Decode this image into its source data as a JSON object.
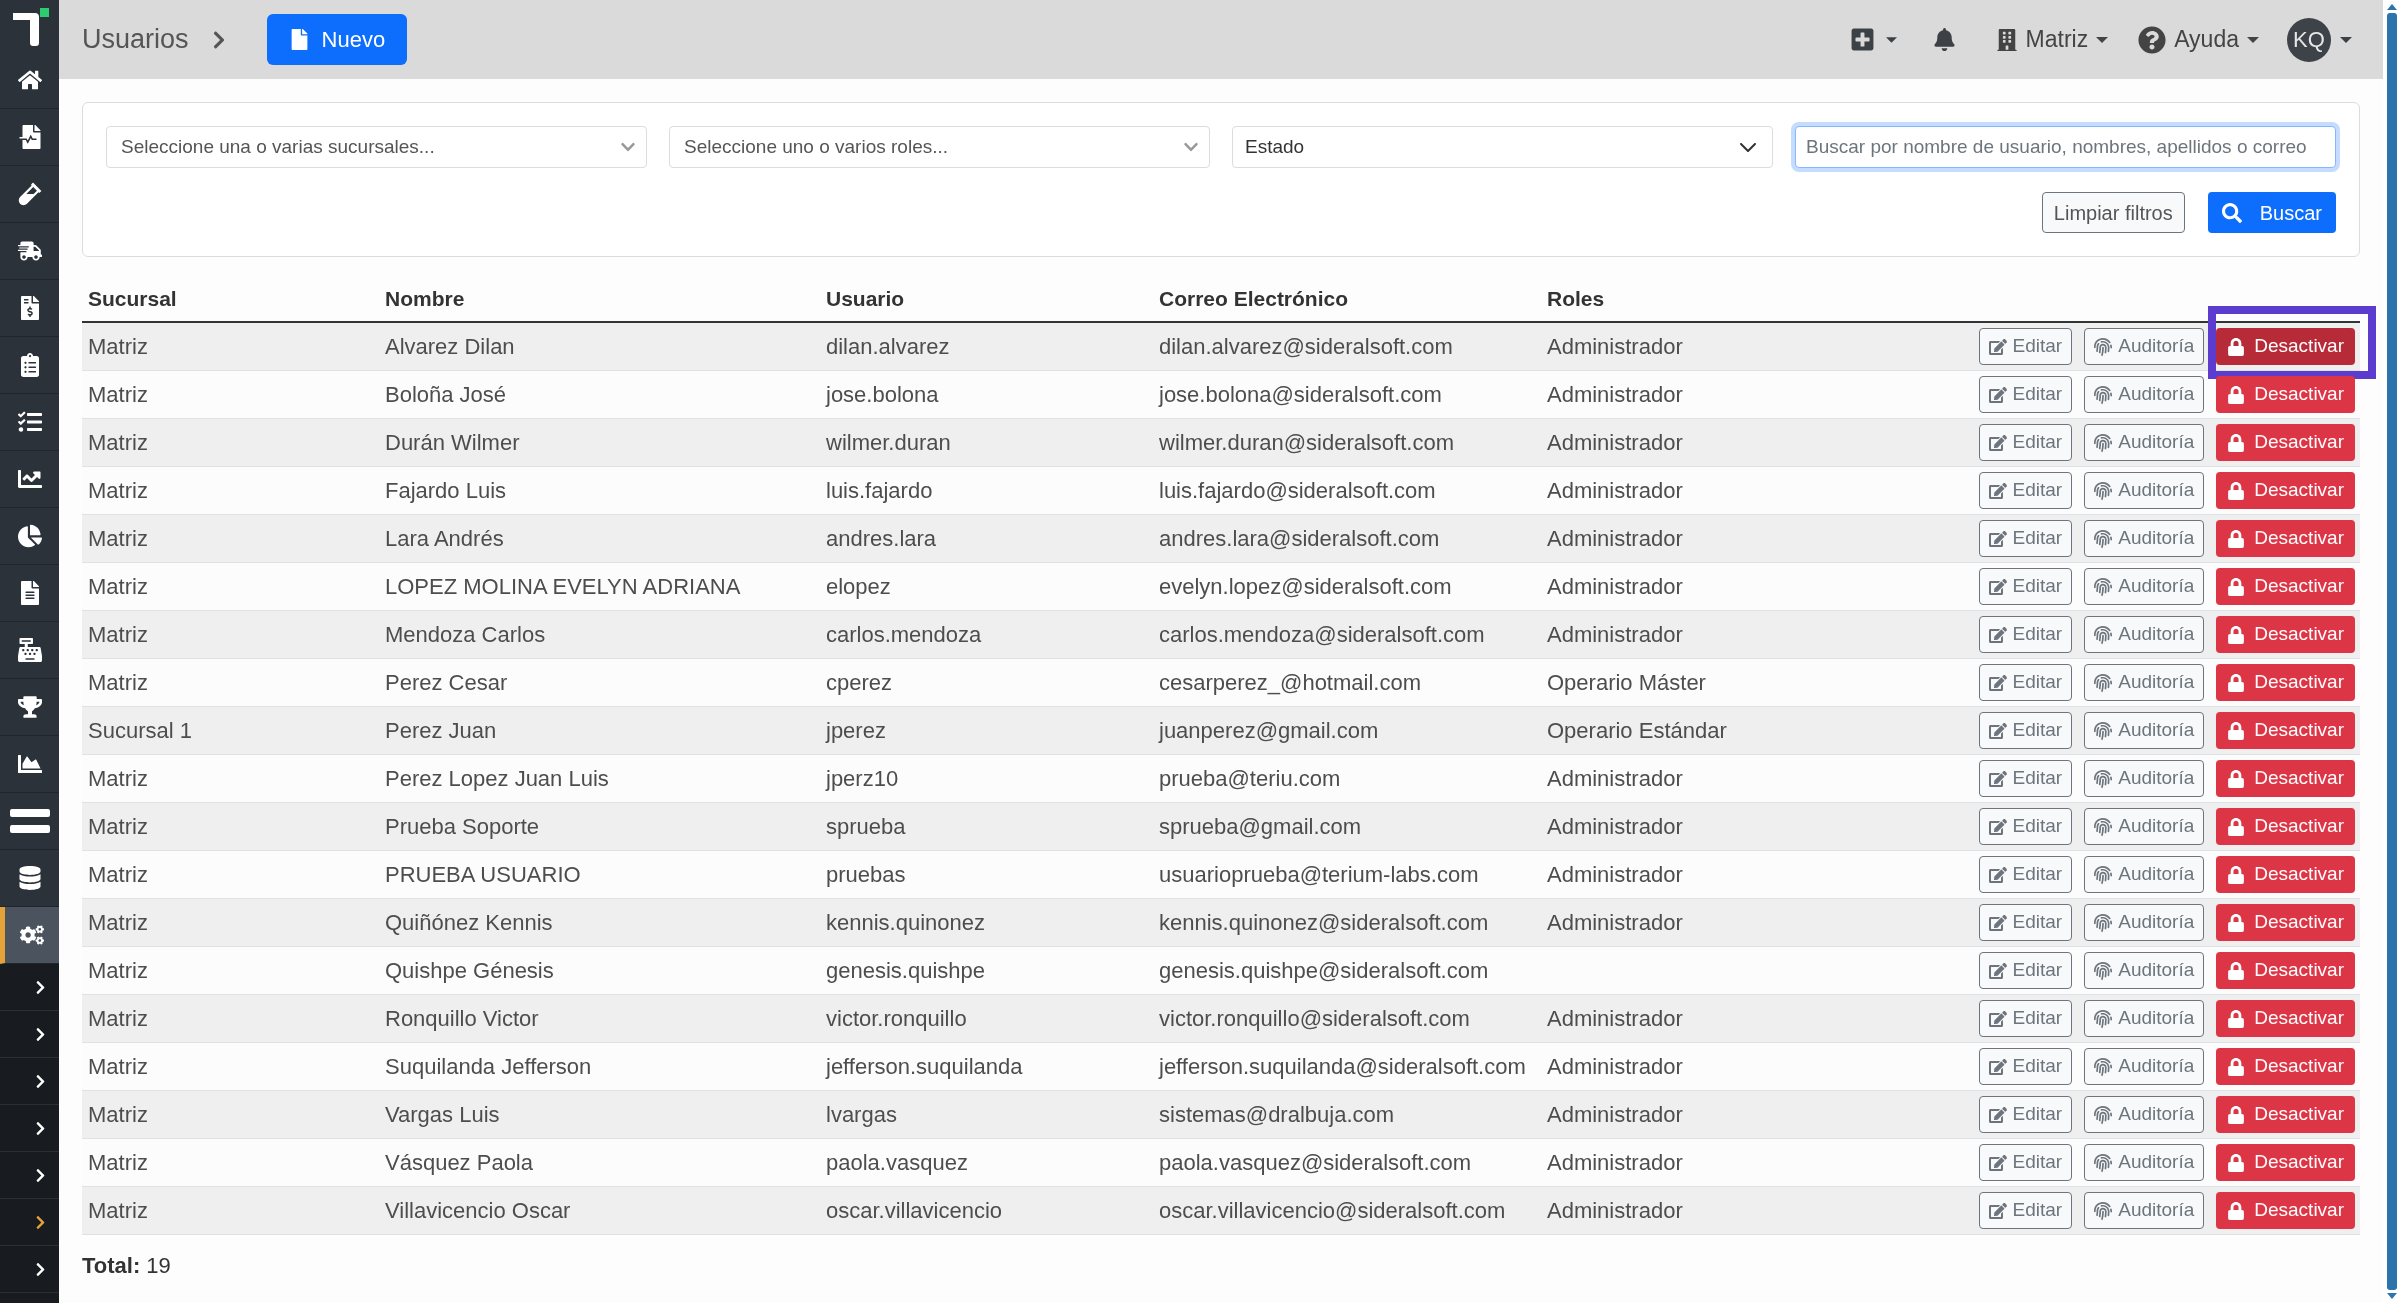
{
  "header": {
    "title": "Usuarios",
    "new_button": "Nuevo",
    "branch_menu": "Matriz",
    "help_menu": "Ayuda",
    "avatar": "KQ"
  },
  "sidebar": {
    "items": [
      {
        "selected": false
      },
      {
        "selected": false
      },
      {
        "selected": false
      },
      {
        "selected": false
      },
      {
        "selected": false
      },
      {
        "selected": false
      },
      {
        "selected": false
      },
      {
        "selected": false
      },
      {
        "selected": false
      },
      {
        "selected": false
      },
      {
        "selected": false
      },
      {
        "selected": false
      },
      {
        "selected": false
      },
      {
        "selected": false
      },
      {
        "selected": false
      },
      {
        "selected": true
      }
    ],
    "submenus": [
      {
        "selected": false
      },
      {
        "selected": false
      },
      {
        "selected": false
      },
      {
        "selected": false
      },
      {
        "selected": false
      },
      {
        "selected": true
      },
      {
        "selected": false
      }
    ]
  },
  "filters": {
    "branch_select": {
      "placeholder": "Seleccione una o varias sucursales..."
    },
    "role_select": {
      "placeholder": "Seleccione uno o varios roles..."
    },
    "status_select": {
      "value": "Estado"
    },
    "search": {
      "placeholder": "Buscar por nombre de usuario, nombres, apellidos o correo",
      "focused": true
    },
    "clear_button": "Limpiar filtros",
    "search_button": "Buscar"
  },
  "table": {
    "columns": [
      "Sucursal",
      "Nombre",
      "Usuario",
      "Correo Electrónico",
      "Roles"
    ],
    "rows": [
      {
        "branch": "Matriz",
        "name": "Alvarez Dilan",
        "username": "dilan.alvarez",
        "email": "dilan.alvarez@sideralsoft.com",
        "role": "Administrador",
        "edit": "Editar",
        "audit": "Auditoría",
        "deactivate": "Desactivar",
        "highlighted": true
      },
      {
        "branch": "Matriz",
        "name": "Boloña José",
        "username": "jose.bolona",
        "email": "jose.bolona@sideralsoft.com",
        "role": "Administrador",
        "edit": "Editar",
        "audit": "Auditoría",
        "deactivate": "Desactivar",
        "highlighted": false
      },
      {
        "branch": "Matriz",
        "name": "Durán Wilmer",
        "username": "wilmer.duran",
        "email": "wilmer.duran@sideralsoft.com",
        "role": "Administrador",
        "edit": "Editar",
        "audit": "Auditoría",
        "deactivate": "Desactivar",
        "highlighted": false
      },
      {
        "branch": "Matriz",
        "name": "Fajardo Luis",
        "username": "luis.fajardo",
        "email": "luis.fajardo@sideralsoft.com",
        "role": "Administrador",
        "edit": "Editar",
        "audit": "Auditoría",
        "deactivate": "Desactivar",
        "highlighted": false
      },
      {
        "branch": "Matriz",
        "name": "Lara Andrés",
        "username": "andres.lara",
        "email": "andres.lara@sideralsoft.com",
        "role": "Administrador",
        "edit": "Editar",
        "audit": "Auditoría",
        "deactivate": "Desactivar",
        "highlighted": false
      },
      {
        "branch": "Matriz",
        "name": "LOPEZ MOLINA EVELYN ADRIANA",
        "username": "elopez",
        "email": "evelyn.lopez@sideralsoft.com",
        "role": "Administrador",
        "edit": "Editar",
        "audit": "Auditoría",
        "deactivate": "Desactivar",
        "highlighted": false
      },
      {
        "branch": "Matriz",
        "name": "Mendoza Carlos",
        "username": "carlos.mendoza",
        "email": "carlos.mendoza@sideralsoft.com",
        "role": "Administrador",
        "edit": "Editar",
        "audit": "Auditoría",
        "deactivate": "Desactivar",
        "highlighted": false
      },
      {
        "branch": "Matriz",
        "name": "Perez Cesar",
        "username": "cperez",
        "email": "cesarperez_@hotmail.com",
        "role": "Operario Máster",
        "edit": "Editar",
        "audit": "Auditoría",
        "deactivate": "Desactivar",
        "highlighted": false
      },
      {
        "branch": "Sucursal 1",
        "name": "Perez Juan",
        "username": "jperez",
        "email": "juanperez@gmail.com",
        "role": "Operario Estándar",
        "edit": "Editar",
        "audit": "Auditoría",
        "deactivate": "Desactivar",
        "highlighted": false
      },
      {
        "branch": "Matriz",
        "name": "Perez Lopez Juan Luis",
        "username": "jperz10",
        "email": "prueba@teriu.com",
        "role": "Administrador",
        "edit": "Editar",
        "audit": "Auditoría",
        "deactivate": "Desactivar",
        "highlighted": false
      },
      {
        "branch": "Matriz",
        "name": "Prueba Soporte",
        "username": "sprueba",
        "email": "sprueba@gmail.com",
        "role": "Administrador",
        "edit": "Editar",
        "audit": "Auditoría",
        "deactivate": "Desactivar",
        "highlighted": false
      },
      {
        "branch": "Matriz",
        "name": "PRUEBA USUARIO",
        "username": "pruebas",
        "email": "usuarioprueba@terium-labs.com",
        "role": "Administrador",
        "edit": "Editar",
        "audit": "Auditoría",
        "deactivate": "Desactivar",
        "highlighted": false
      },
      {
        "branch": "Matriz",
        "name": "Quiñónez Kennis",
        "username": "kennis.quinonez",
        "email": "kennis.quinonez@sideralsoft.com",
        "role": "Administrador",
        "edit": "Editar",
        "audit": "Auditoría",
        "deactivate": "Desactivar",
        "highlighted": false
      },
      {
        "branch": "Matriz",
        "name": "Quishpe Génesis",
        "username": "genesis.quishpe",
        "email": "genesis.quishpe@sideralsoft.com",
        "edit": "Editar",
        "audit": "Auditoría",
        "deactivate": "Desactivar",
        "highlighted": false
      },
      {
        "branch": "Matriz",
        "name": "Ronquillo Victor",
        "username": "victor.ronquillo",
        "email": "victor.ronquillo@sideralsoft.com",
        "role": "Administrador",
        "edit": "Editar",
        "audit": "Auditoría",
        "deactivate": "Desactivar",
        "highlighted": false
      },
      {
        "branch": "Matriz",
        "name": "Suquilanda Jefferson",
        "username": "jefferson.suquilanda",
        "email": "jefferson.suquilanda@sideralsoft.com",
        "role": "Administrador",
        "edit": "Editar",
        "audit": "Auditoría",
        "deactivate": "Desactivar",
        "highlighted": false
      },
      {
        "branch": "Matriz",
        "name": "Vargas Luis",
        "username": "lvargas",
        "email": "sistemas@dralbuja.com",
        "role": "Administrador",
        "edit": "Editar",
        "audit": "Auditoría",
        "deactivate": "Desactivar",
        "highlighted": false
      },
      {
        "branch": "Matriz",
        "name": "Vásquez Paola",
        "username": "paola.vasquez",
        "email": "paola.vasquez@sideralsoft.com",
        "role": "Administrador",
        "edit": "Editar",
        "audit": "Auditoría",
        "deactivate": "Desactivar",
        "highlighted": false
      },
      {
        "branch": "Matriz",
        "name": "Villavicencio Oscar",
        "username": "oscar.villavicencio",
        "email": "oscar.villavicencio@sideralsoft.com",
        "role": "Administrador",
        "edit": "Editar",
        "audit": "Auditoría",
        "deactivate": "Desactivar",
        "highlighted": false
      }
    ]
  },
  "total": "**Total:** 19"
}
